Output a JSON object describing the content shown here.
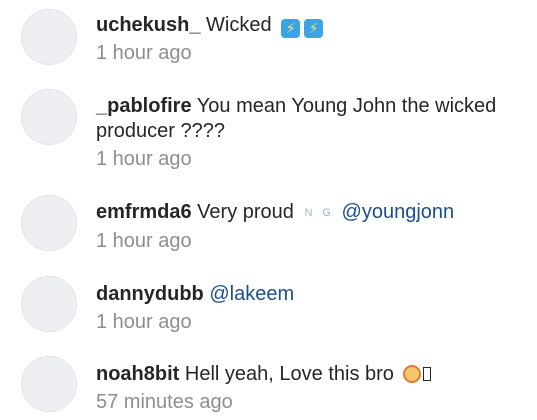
{
  "comments": [
    {
      "username": "uchekush_",
      "text": "Wicked",
      "emojis": [
        "high-voltage-emoji",
        "high-voltage-emoji"
      ],
      "time": "1 hour ago"
    },
    {
      "username": "_pablofire",
      "text": "You mean Young John the wicked producer ????",
      "time": "1 hour ago"
    },
    {
      "username": "emfrmda6",
      "text": "Very proud",
      "flag_letters": [
        "N",
        "G"
      ],
      "mention": "@youngjonn",
      "time": "1 hour ago"
    },
    {
      "username": "dannydubb",
      "mention": "@lakeem",
      "time": "1 hour ago"
    },
    {
      "username": "noah8bit",
      "text": "Hell yeah, Love this bro",
      "emojis": [
        "person-facepalming-emoji",
        "unsupported-glyph"
      ],
      "time": "57 minutes ago"
    }
  ]
}
